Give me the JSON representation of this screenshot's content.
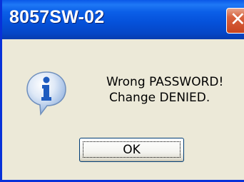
{
  "window": {
    "title": "8057SW-02",
    "close_icon": "close-icon"
  },
  "message": {
    "line1": "Wrong PASSWORD!",
    "line2": "Change DENIED.",
    "icon": "info-icon"
  },
  "buttons": {
    "ok_label": "OK"
  },
  "colors": {
    "titlebar": "#0552db",
    "close_button": "#d8623f",
    "background": "#ece9d8",
    "icon_blue": "#1e5bbf"
  }
}
